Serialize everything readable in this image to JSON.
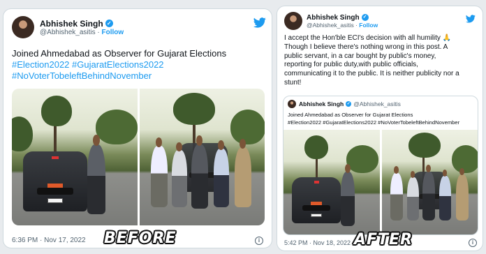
{
  "before": {
    "author": {
      "name": "Abhishek Singh",
      "handle": "@Abhishek_asitis",
      "follow": "Follow"
    },
    "text": {
      "line1": "Joined  Ahmedabad as Observer for Gujarat Elections",
      "line2": "#Election2022 #GujaratElections2022",
      "line3": "#NoVoterTobeleftBehindNovember"
    },
    "timestamp": "6:36 PM · Nov 17, 2022",
    "stamp": "BEFORE",
    "info": "i"
  },
  "after": {
    "author": {
      "name": "Abhishek Singh",
      "handle": "@Abhishek_asitis",
      "follow": "Follow"
    },
    "text": {
      "line1": "I accept the Hon'ble ECI's decision with all humility 🙏",
      "line2": "Though I believe there's nothing wrong in this post. A",
      "line3": "public servant, in a car bought by public's money,",
      "line4": "reporting for public duty,with public officials,",
      "line5": "communicating it to the public. It is neither publicity nor a",
      "line6": "stunt!"
    },
    "quoted": {
      "name": "Abhishek Singh",
      "handle": "@Abhishek_asitis",
      "line1": "Joined  Ahmedabad as Observer for Gujarat Elections",
      "line2": "#Election2022 #GujaratElections2022 #NoVoterTobeleftBehindNovember"
    },
    "timestamp": "5:42 PM · Nov 18, 2022",
    "stamp": "AFTER",
    "info": "i"
  },
  "colors": {
    "accent": "#1d9bf0",
    "text": "#0f1419",
    "muted": "#536471"
  },
  "icons": [
    "twitter-bird-icon",
    "verified-badge-icon",
    "info-icon"
  ]
}
